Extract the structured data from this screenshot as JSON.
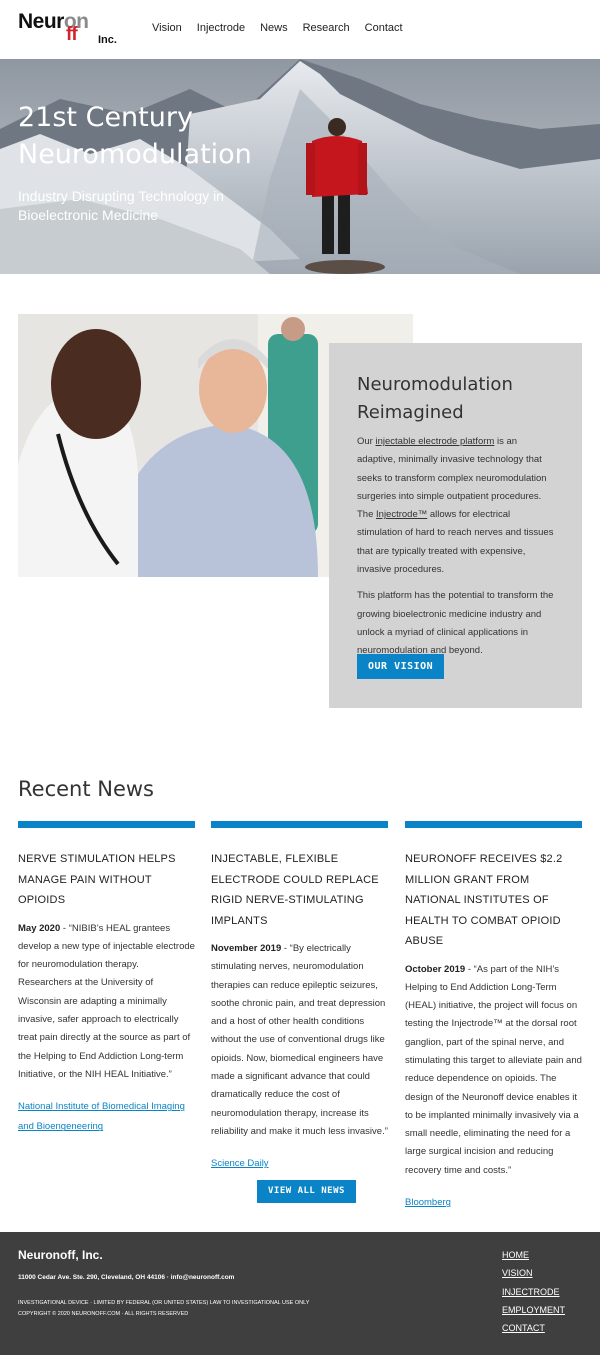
{
  "header": {
    "logo": {
      "part1": "Neur",
      "part2": "on",
      "part3": "ff",
      "inc": "Inc."
    },
    "nav": [
      "Vision",
      "Injectrode",
      "News",
      "Research",
      "Contact"
    ]
  },
  "hero": {
    "title": "21st Century Neuromodulation",
    "subtitle": "Industry Disrupting Technology in Bioelectronic Medicine"
  },
  "vision": {
    "heading": "Neuromodulation Reimagined",
    "p1_a": "Our ",
    "p1_link": "injectable electrode platform",
    "p1_b": " is an adaptive, minimally invasive technology that seeks to transform complex neuromodulation surgeries into simple outpatient procedures. The ",
    "p1_link2": "Injectrode™",
    "p1_c": " allows for electrical stimulation of hard to reach nerves and tissues that are typically treated with expensive, invasive procedures.",
    "p2": "This platform has the potential to transform the growing bioelectronic medicine industry and unlock a myriad of clinical applications in neuromodulation and beyond.",
    "button": "OUR VISION"
  },
  "news": {
    "title": "Recent News",
    "items": [
      {
        "headline": "NERVE STIMULATION HELPS MANAGE PAIN WITHOUT OPIOIDS",
        "date": "May 2020",
        "body": " - “NIBIB’s HEAL grantees develop a new type of injectable electrode for neuromodulation therapy. Researchers at the University of Wisconsin are adapting a minimally invasive, safer approach to electrically treat pain directly at the source as part of the Helping to End Addiction Long-term Initiative, or the NIH HEAL Initiative.”",
        "source": "National Institute of Biomedical Imaging and Bioengeneering"
      },
      {
        "headline": "INJECTABLE, FLEXIBLE ELECTRODE COULD REPLACE RIGID NERVE-STIMULATING IMPLANTS",
        "date": "November 2019",
        "body": " - “By electrically stimulating nerves, neuromodulation therapies can reduce epileptic seizures, soothe chronic pain, and treat depression and a host of other health conditions without the use of conventional drugs like opioids. Now, biomedical engineers have made a significant advance that could dramatically reduce the cost of neuromodulation therapy, increase its reliability and make it much less invasive.”",
        "source": "Science Daily"
      },
      {
        "headline": "NEURONOFF RECEIVES $2.2 MILLION GRANT FROM NATIONAL INSTITUTES OF HEALTH TO COMBAT OPIOID ABUSE",
        "date": "October 2019",
        "body": " - “As part of the NIH’s Helping to End Addiction Long-Term (HEAL) initiative, the project will focus on testing the Injectrode™ at the dorsal root ganglion, part of the spinal nerve, and stimulating this target to alleviate pain and reduce dependence on opioids. The design of the Neuronoff device enables it to be implanted minimally invasively via a small needle, eliminating the need for a large surgical incision and reducing recovery time and costs.”",
        "source": "Bloomberg"
      }
    ],
    "view_all": "VIEW ALL NEWS"
  },
  "footer": {
    "company": "Neuronoff, Inc.",
    "address": "11000 Cedar Ave. Ste. 290, Cleveland, OH 44106  ·  info@neuronoff.com",
    "legal1": "INVESTIGATIONAL DEVICE · LIMITED BY FEDERAL (OR UNITED STATES) LAW TO INVESTIGATIONAL USE ONLY",
    "legal2": "COPYRIGHT © 2020 NEURONOFF.COM · ALL RIGHTS RESERVED",
    "nav": [
      "HOME",
      "VISION",
      "INJECTRODE",
      "EMPLOYMENT",
      "CONTACT"
    ]
  },
  "colors": {
    "accent": "#0a84c6",
    "logo_red": "#d2232a",
    "footer_bg": "#3f3f3f",
    "card_bg": "#d3d3d3"
  }
}
